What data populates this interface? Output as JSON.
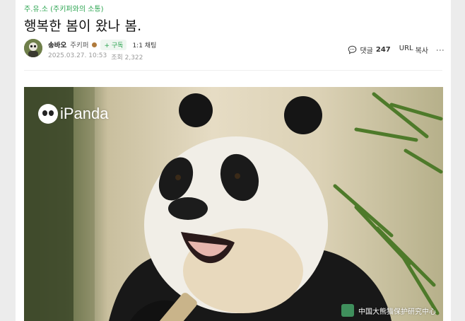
{
  "breadcrumb": "주.유.소 (주키퍼와의 소통)",
  "post": {
    "title": "행복한 봄이 왔나 봄.",
    "author": {
      "nickname": "송바오",
      "grade": "주키퍼",
      "subscribe_label": "+ 구독",
      "chat_label": "1:1 채팅"
    },
    "date": "2025.03.27. 10:53",
    "views_label": "조회 2,322"
  },
  "actions": {
    "comment_label": "댓글",
    "comment_count": "247",
    "url_label": "URL",
    "copy_label": "복사",
    "more_label": "⋮"
  },
  "image": {
    "logo_text": "iPanda",
    "watermark_text": "中国大熊猫保护研究中心"
  },
  "colors": {
    "accent": "#2aa44f",
    "meta": "#9a9a9a"
  }
}
